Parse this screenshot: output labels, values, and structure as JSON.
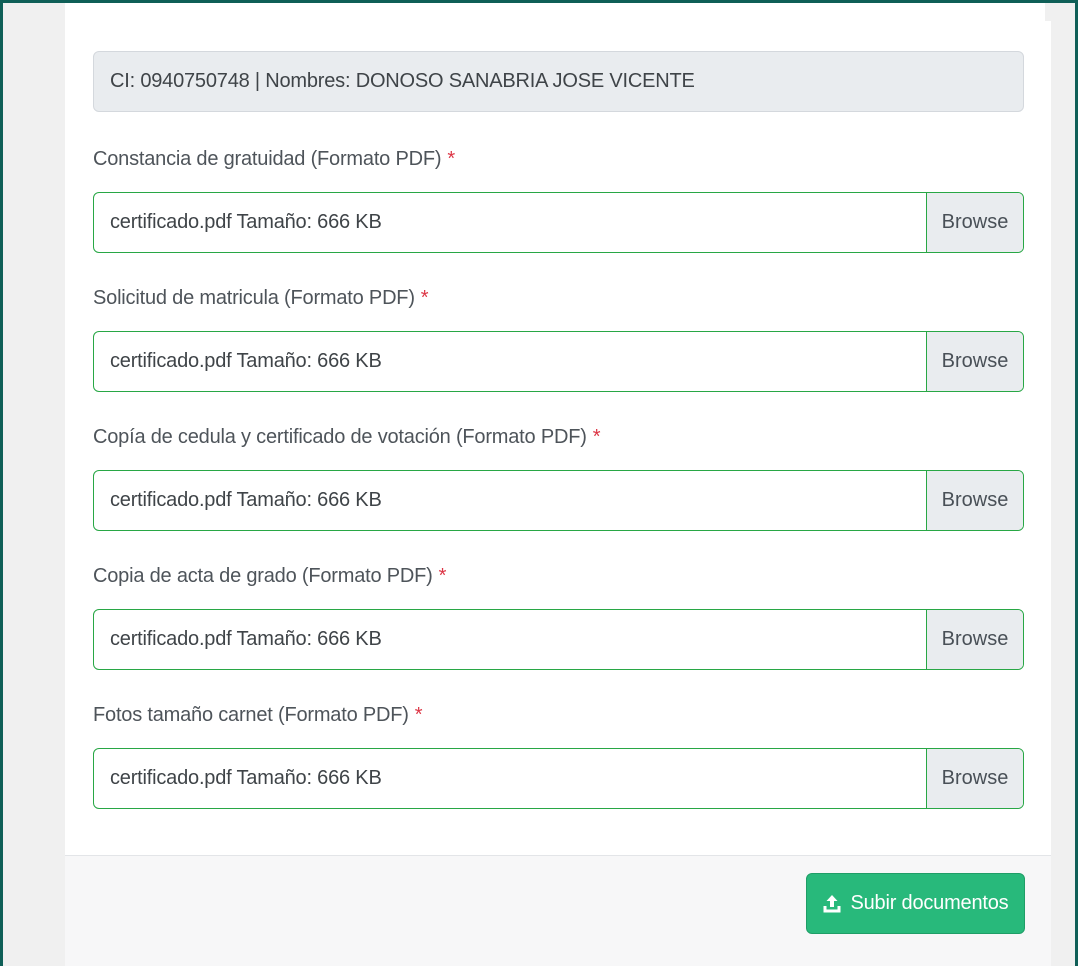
{
  "student": {
    "info": "CI: 0940750748 | Nombres: DONOSO SANABRIA JOSE VICENTE"
  },
  "fields": [
    {
      "label": "Constancia de gratuidad (Formato PDF)",
      "required_mark": "*",
      "file": "certificado.pdf Tamaño: 666 KB",
      "button": "Browse"
    },
    {
      "label": "Solicitud de matricula (Formato PDF)",
      "required_mark": "*",
      "file": "certificado.pdf Tamaño: 666 KB",
      "button": "Browse"
    },
    {
      "label": "Copía de cedula y certificado de votación (Formato PDF)",
      "required_mark": "*",
      "file": "certificado.pdf Tamaño: 666 KB",
      "button": "Browse"
    },
    {
      "label": "Copia de acta de grado (Formato PDF)",
      "required_mark": "*",
      "file": "certificado.pdf Tamaño: 666 KB",
      "button": "Browse"
    },
    {
      "label": "Fotos tamaño carnet (Formato PDF)",
      "required_mark": "*",
      "file": "certificado.pdf Tamaño: 666 KB",
      "button": "Browse"
    }
  ],
  "footer": {
    "submit_label": "Subir documentos",
    "submit_icon": "upload-icon"
  },
  "colors": {
    "frame_border": "#0f5f57",
    "input_border": "#28a745",
    "submit_bg": "#28b97b",
    "required": "#dc3545"
  }
}
